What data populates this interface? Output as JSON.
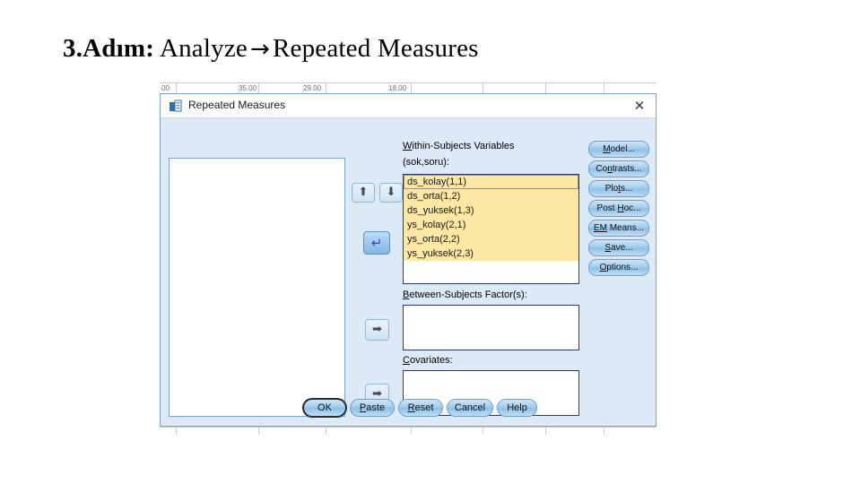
{
  "slide": {
    "title_step": "3.Adım:",
    "title_rest_before": "Analyze",
    "title_arrow": "→",
    "title_rest_after": "Repeated Measures"
  },
  "background": {
    "cells": [
      "00",
      "35.00",
      "29.00",
      "18.00"
    ]
  },
  "dialog": {
    "icon": "spss-dialog-icon",
    "title": "Repeated Measures",
    "close_label": "✕",
    "source_list": {
      "label": "source-variable-list",
      "items": []
    },
    "within_subjects": {
      "label_mnemonic": "W",
      "label_rest": "ithin-Subjects Variables",
      "sublabel": "(sok,soru):",
      "items": [
        "ds_kolay(1,1)",
        "ds_orta(1,2)",
        "ds_yuksek(1,3)",
        "ys_kolay(2,1)",
        "ys_orta(2,2)",
        "ys_yuksek(2,3)"
      ],
      "selected_index": 0
    },
    "between_subjects": {
      "label_mnemonic": "B",
      "label_rest": "etween-Subjects Factor(s):",
      "items": []
    },
    "covariates": {
      "label_mnemonic": "C",
      "label_rest": "ovariates:",
      "items": []
    },
    "transfer_buttons": {
      "up": "⬆",
      "down": "⬇",
      "to_within": "↵",
      "to_between": "➡",
      "to_covariates": "➡"
    },
    "side_buttons": [
      {
        "mnemonic": "M",
        "rest": "odel..."
      },
      {
        "pre": "Co",
        "mnemonic": "n",
        "rest": "trasts..."
      },
      {
        "pre": "Plo",
        "mnemonic": "t",
        "rest": "s..."
      },
      {
        "pre": "Post ",
        "mnemonic": "H",
        "rest": "oc..."
      },
      {
        "mnemonic": "EM",
        "rest": " Means..."
      },
      {
        "mnemonic": "S",
        "rest": "ave..."
      },
      {
        "mnemonic": "O",
        "rest": "ptions..."
      }
    ],
    "bottom_buttons": [
      {
        "label": "OK",
        "focused": true
      },
      {
        "mnemonic": "P",
        "rest": "aste",
        "focused": false
      },
      {
        "mnemonic": "R",
        "rest": "eset",
        "focused": false
      },
      {
        "label": "Cancel",
        "focused": false
      },
      {
        "label": "Help",
        "focused": false
      }
    ]
  },
  "colors": {
    "dialog_bg": "#dce9f7",
    "titlebar_bg": "#ffffff",
    "list_highlight": "#fce7a4",
    "button_blue": "#9ccaed",
    "listbox_border": "#2a3a7a"
  }
}
